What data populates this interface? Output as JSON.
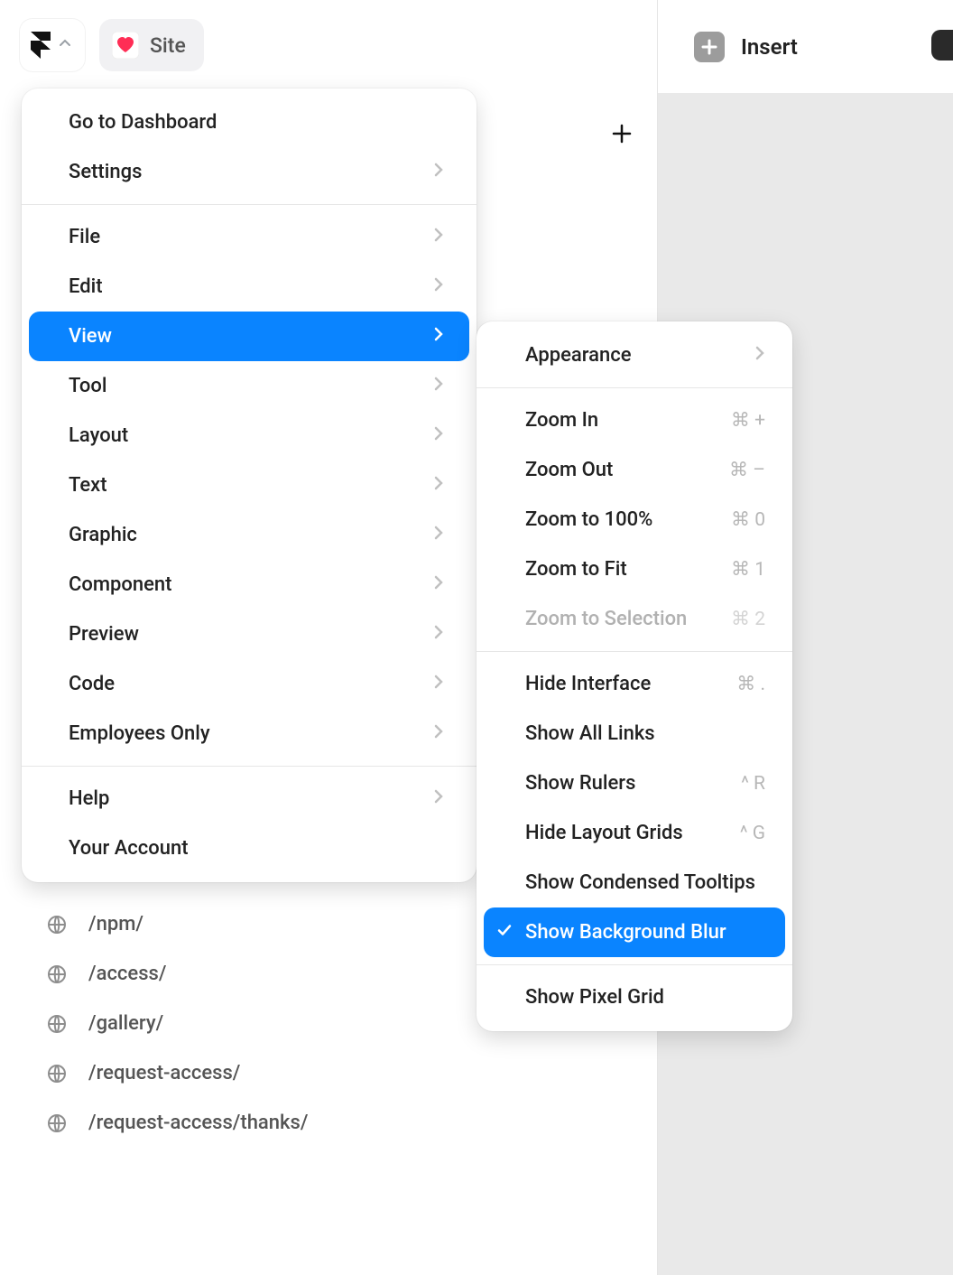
{
  "topbar": {
    "site_label": "Site",
    "insert_label": "Insert"
  },
  "pages": [
    {
      "path": "/npm/"
    },
    {
      "path": "/access/"
    },
    {
      "path": "/gallery/"
    },
    {
      "path": "/request-access/"
    },
    {
      "path": "/request-access/thanks/"
    }
  ],
  "main_menu": {
    "top": [
      {
        "label": "Go to Dashboard",
        "chevron": false
      },
      {
        "label": "Settings",
        "chevron": true
      }
    ],
    "middle": [
      {
        "label": "File",
        "chevron": true
      },
      {
        "label": "Edit",
        "chevron": true
      },
      {
        "label": "View",
        "chevron": true,
        "active": true
      },
      {
        "label": "Tool",
        "chevron": true
      },
      {
        "label": "Layout",
        "chevron": true
      },
      {
        "label": "Text",
        "chevron": true
      },
      {
        "label": "Graphic",
        "chevron": true
      },
      {
        "label": "Component",
        "chevron": true
      },
      {
        "label": "Preview",
        "chevron": true
      },
      {
        "label": "Code",
        "chevron": true
      },
      {
        "label": "Employees Only",
        "chevron": true
      }
    ],
    "bottom": [
      {
        "label": "Help",
        "chevron": true
      },
      {
        "label": "Your Account",
        "chevron": false
      }
    ]
  },
  "submenu": {
    "group1": [
      {
        "label": "Appearance",
        "chevron": true
      }
    ],
    "group2": [
      {
        "label": "Zoom In",
        "shortcut": "⌘ +"
      },
      {
        "label": "Zoom Out",
        "shortcut": "⌘ –"
      },
      {
        "label": "Zoom to 100%",
        "shortcut": "⌘ 0"
      },
      {
        "label": "Zoom to Fit",
        "shortcut": "⌘ 1"
      },
      {
        "label": "Zoom to Selection",
        "shortcut": "⌘ 2",
        "disabled": true
      }
    ],
    "group3": [
      {
        "label": "Hide Interface",
        "shortcut": "⌘ ."
      },
      {
        "label": "Show All Links"
      },
      {
        "label": "Show Rulers",
        "shortcut": "^ R"
      },
      {
        "label": "Hide Layout Grids",
        "shortcut": "^ G"
      },
      {
        "label": "Show Condensed Tooltips"
      },
      {
        "label": "Show Background Blur",
        "checked": true,
        "active": true
      }
    ],
    "group4": [
      {
        "label": "Show Pixel Grid"
      }
    ]
  }
}
